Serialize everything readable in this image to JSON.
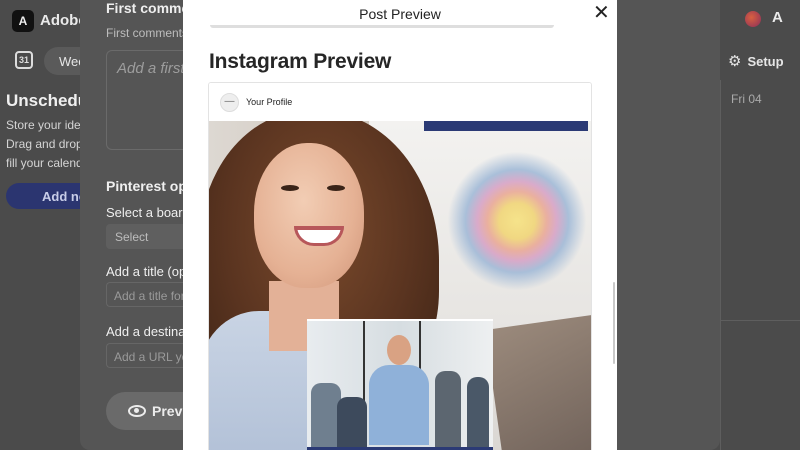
{
  "app": {
    "name": "Adobe",
    "logo_icon": "adobe-express-logo-icon",
    "adobe_icon": "adobe-icon",
    "week_label": "Wee",
    "setup_label": "Setup",
    "day_label": "Fri 04",
    "unscheduled": {
      "title": "Unschedu",
      "lines": [
        "Store your idea",
        "Drag and drop",
        "fill your calend"
      ],
      "add_button": "Add ne"
    }
  },
  "panel": {
    "first_comment_heading": "First commen",
    "first_comment_sub": "First comments",
    "first_comment_placeholder": "Add a first",
    "pinterest_heading": "Pinterest opt",
    "select_board_label": "Select a board",
    "select_board_value": "Select",
    "title_label": "Add a title (opti",
    "title_placeholder": "Add a title for y",
    "destination_label": "Add a destinati",
    "url_placeholder": "Add a URL yo",
    "preview_button": "Previ"
  },
  "modal": {
    "title": "Post Preview",
    "close_glyph": "✕",
    "heading": "Instagram Preview",
    "profile_name": "Your Profile",
    "avatar_glyph": "—"
  },
  "colors": {
    "accent_navy": "#2b3a75",
    "backdrop": "#4b4b4b",
    "modal_bg": "#ffffff"
  }
}
